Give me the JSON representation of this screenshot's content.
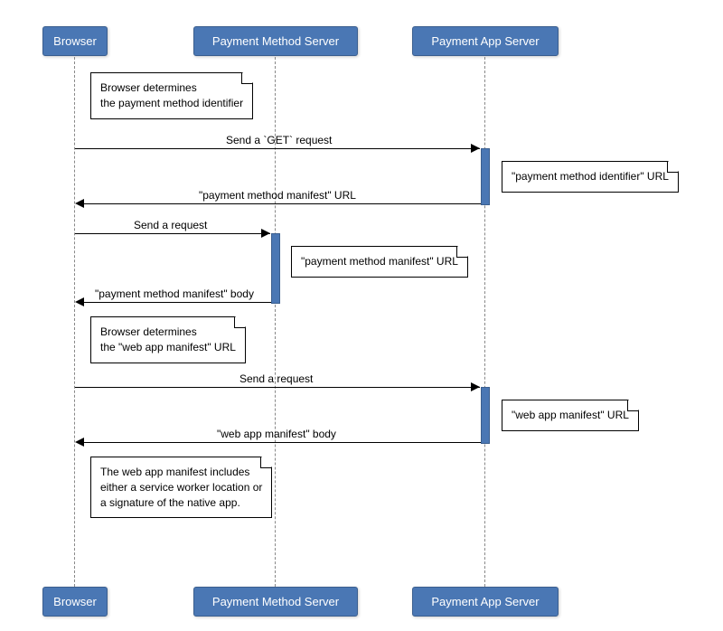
{
  "participants": {
    "browser": "Browser",
    "pms": "Payment Method Server",
    "pas": "Payment App Server"
  },
  "notes": {
    "n1_l1": "Browser determines",
    "n1_l2": "the payment method identifier",
    "n2": "\"payment method identifier\" URL",
    "n3": "\"payment method manifest\" URL",
    "n4_l1": "Browser determines",
    "n4_l2": "the \"web app manifest\" URL",
    "n5": "\"web app manifest\" URL",
    "n6_l1": "The web app manifest includes",
    "n6_l2": "either a service worker location or",
    "n6_l3": "a signature of the native app."
  },
  "messages": {
    "m1": "Send a `GET` request",
    "m2": "\"payment method manifest\" URL",
    "m3": "Send a request",
    "m4": "\"payment method manifest\" body",
    "m5": "Send a request",
    "m6": "\"web app manifest\" body"
  }
}
